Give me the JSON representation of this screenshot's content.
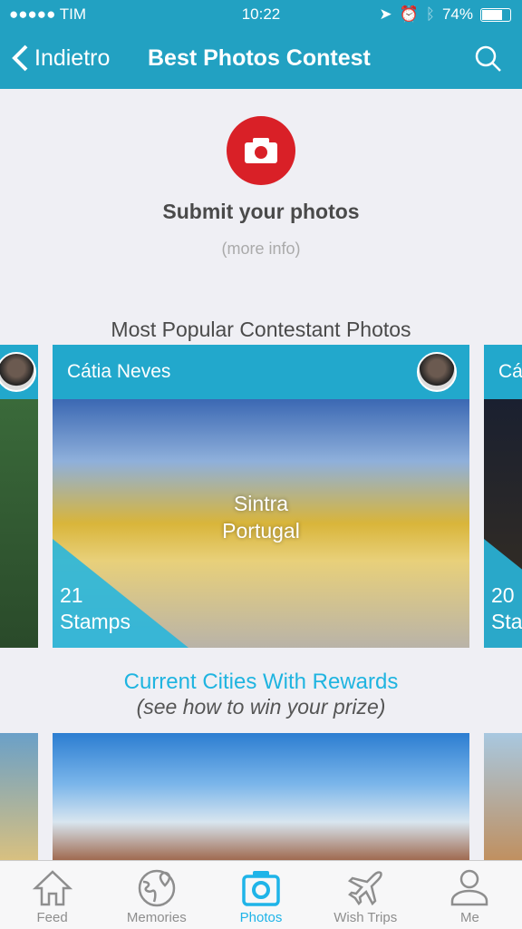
{
  "status": {
    "carrier": "●●●●● TIM",
    "time": "10:22",
    "battery": "74%",
    "battery_level": 0.74
  },
  "header": {
    "back_label": "Indietro",
    "title": "Best Photos Contest"
  },
  "submit": {
    "label": "Submit your photos",
    "more_info": "(more info)",
    "accent": "#d92027"
  },
  "popular": {
    "title": "Most Popular Contestant Photos",
    "cards": [
      {
        "name": "",
        "stamps": ""
      },
      {
        "name": "Cátia Neves",
        "location_line1": "Sintra",
        "location_line2": "Portugal",
        "stamps_count": "21",
        "stamps_label": "Stamps"
      },
      {
        "name": "Cá",
        "stamps_count": "20",
        "stamps_label": "Sta"
      }
    ]
  },
  "rewards": {
    "title": "Current Cities With Rewards",
    "subtitle": "(see how to win your prize)"
  },
  "tabs": [
    {
      "label": "Feed",
      "icon": "home-icon"
    },
    {
      "label": "Memories",
      "icon": "globe-pin-icon"
    },
    {
      "label": "Photos",
      "icon": "camera-icon",
      "active": true
    },
    {
      "label": "Wish Trips",
      "icon": "airplane-icon"
    },
    {
      "label": "Me",
      "icon": "person-icon"
    }
  ],
  "colors": {
    "header": "#22a1c2",
    "active_tab": "#1fb4e8"
  }
}
